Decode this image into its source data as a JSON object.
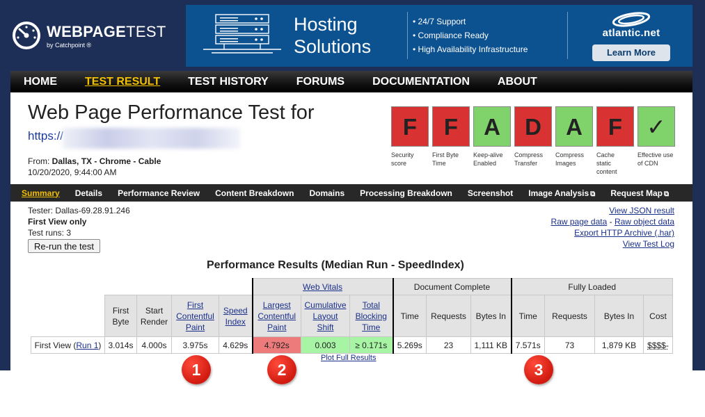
{
  "brand": {
    "name_bold": "WEBPAGE",
    "name_thin": "TEST",
    "by": "by Catchpoint ®"
  },
  "ad": {
    "title_line1": "Hosting",
    "title_line2": "Solutions",
    "bullets": [
      "• 24/7 Support",
      "• Compliance Ready",
      "• High Availability Infrastructure"
    ],
    "brand": "atlantic.net",
    "cta": "Learn More"
  },
  "nav": {
    "items": [
      "HOME",
      "TEST RESULT",
      "TEST HISTORY",
      "FORUMS",
      "DOCUMENTATION",
      "ABOUT"
    ],
    "active_index": 1
  },
  "header": {
    "title": "Web Page Performance Test for",
    "url_visible": "https://",
    "from_label": "From:",
    "from_value": " Dallas, TX - Chrome - Cable",
    "date": "10/20/2020, 9:44:00 AM"
  },
  "grades": [
    {
      "letter": "F",
      "label": "Security score",
      "color": "#d93232"
    },
    {
      "letter": "F",
      "label": "First Byte Time",
      "color": "#d93232"
    },
    {
      "letter": "A",
      "label": "Keep-alive Enabled",
      "color": "#7fd36a"
    },
    {
      "letter": "D",
      "label": "Compress Transfer",
      "color": "#d93232"
    },
    {
      "letter": "A",
      "label": "Compress Images",
      "color": "#7fd36a"
    },
    {
      "letter": "F",
      "label": "Cache static content",
      "color": "#d93232"
    },
    {
      "letter": "✓",
      "label": "Effective use of CDN",
      "color": "#7fd36a"
    }
  ],
  "subnav": {
    "items": [
      "Summary",
      "Details",
      "Performance Review",
      "Content Breakdown",
      "Domains",
      "Processing Breakdown",
      "Screenshot",
      "Image Analysis",
      "Request Map"
    ]
  },
  "meta": {
    "tester": "Tester: Dallas-69.28.91.246",
    "view_mode": "First View only",
    "test_runs": "Test runs: 3",
    "rerun_button": "Re-run the test"
  },
  "result_links": [
    "View JSON result",
    "Raw page data",
    "Raw object data",
    "Export HTTP Archive (.har)",
    "View Test Log"
  ],
  "results": {
    "title": "Performance Results (Median Run - SpeedIndex)",
    "group_headers": [
      "Web Vitals",
      "Document Complete",
      "Fully Loaded"
    ],
    "col_headers": {
      "first_byte": "First Byte",
      "start_render": "Start Render",
      "fcp": "First Contentful Paint",
      "speed_index": "Speed Index",
      "lcp": "Largest Contentful Paint",
      "cls": "Cumulative Layout Shift",
      "tbt": "Total Blocking Time",
      "dc_time": "Time",
      "dc_requests": "Requests",
      "dc_bytes": "Bytes In",
      "fl_time": "Time",
      "fl_requests": "Requests",
      "fl_bytes": "Bytes In",
      "fl_cost": "Cost"
    },
    "row": {
      "label": "First View (",
      "run_link": "Run 1",
      "label_close": ")",
      "first_byte": "3.014s",
      "start_render": "4.000s",
      "fcp": "3.975s",
      "speed_index": "4.629s",
      "lcp": "4.792s",
      "cls": "0.003",
      "tbt": "≥ 0.171s",
      "dc_time": "5.269s",
      "dc_requests": "23",
      "dc_bytes": "1,111 KB",
      "fl_time": "7.571s",
      "fl_requests": "73",
      "fl_bytes": "1,879 KB",
      "fl_cost": "$$$$-"
    },
    "plot_link": "Plot Full Results"
  },
  "markers": [
    "1",
    "2",
    "3"
  ]
}
